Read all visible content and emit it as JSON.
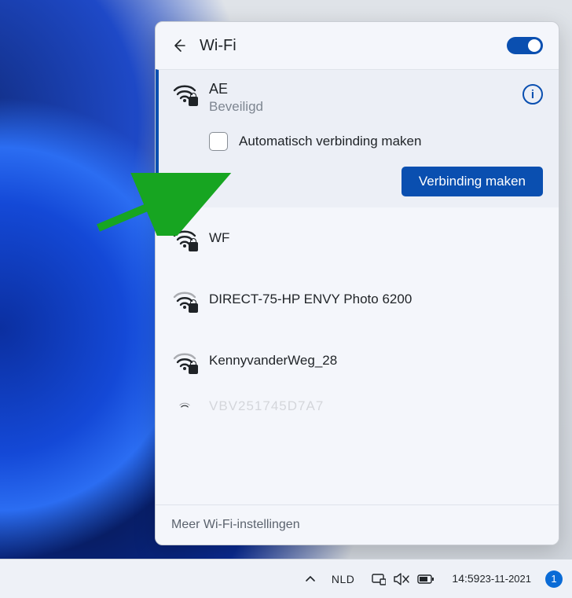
{
  "header": {
    "title": "Wi-Fi",
    "toggle_on": true
  },
  "selected_network": {
    "name": "AE",
    "status": "Beveiligd",
    "auto_connect_label": "Automatisch verbinding maken",
    "connect_label": "Verbinding maken"
  },
  "networks": [
    {
      "name": "WF",
      "secured": true,
      "strength": 3
    },
    {
      "name": "DIRECT-75-HP ENVY Photo 6200",
      "secured": true,
      "strength": 2
    },
    {
      "name": "KennyvanderWeg_28",
      "secured": true,
      "strength": 2
    }
  ],
  "partial_network": "VBV251745D7A7",
  "footer": {
    "more_settings_label": "Meer Wi-Fi-instellingen"
  },
  "taskbar": {
    "lang": "NLD",
    "time": "14:59",
    "date": "23-11-2021",
    "notification_count": "1"
  },
  "icons": {
    "back": "back-arrow-icon",
    "info": "i"
  }
}
